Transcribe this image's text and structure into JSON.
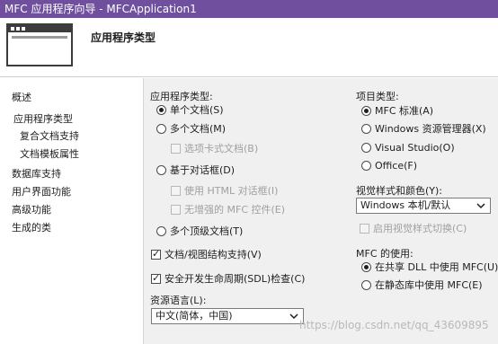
{
  "window": {
    "title": "MFC 应用程序向导 - MFCApplication1"
  },
  "header": {
    "title": "应用程序类型"
  },
  "sidebar": {
    "items": [
      {
        "label": "概述"
      },
      {
        "label": "应用程序类型"
      },
      {
        "label": "复合文档支持"
      },
      {
        "label": "文档模板属性"
      },
      {
        "label": "数据库支持"
      },
      {
        "label": "用户界面功能"
      },
      {
        "label": "高级功能"
      },
      {
        "label": "生成的类"
      }
    ]
  },
  "app_type": {
    "heading": "应用程序类型:",
    "single_doc": "单个文档(S)",
    "multi_doc": "多个文档(M)",
    "tabbed_docs": "选项卡式文档(B)",
    "dialog_based": "基于对话框(D)",
    "use_html_dialog": "使用 HTML 对话框(I)",
    "no_enhanced_mfc": "无增强的 MFC 控件(E)",
    "multi_toplevel": "多个顶级文档(T)",
    "doc_view_support": "文档/视图结构支持(V)",
    "sdl_checks": "安全开发生命周期(SDL)检查(C)",
    "selected": "single_doc"
  },
  "resource_language": {
    "label": "资源语言(L):",
    "value": "中文(简体，中国)"
  },
  "project_type": {
    "heading": "项目类型:",
    "mfc_standard": "MFC 标准(A)",
    "windows_explorer": "Windows 资源管理器(X)",
    "visual_studio": "Visual Studio(O)",
    "office": "Office(F)",
    "selected": "mfc_standard"
  },
  "visual_style": {
    "label": "视觉样式和颜色(Y):",
    "value": "Windows 本机/默认",
    "enable_switching": "启用视觉样式切换(C)"
  },
  "mfc_use": {
    "heading": "MFC 的使用:",
    "shared_dll": "在共享 DLL 中使用 MFC(U)",
    "static_lib": "在静态库中使用 MFC(E)",
    "selected": "shared_dll"
  },
  "watermark": "https://blog.csdn.net/qq_43609895"
}
